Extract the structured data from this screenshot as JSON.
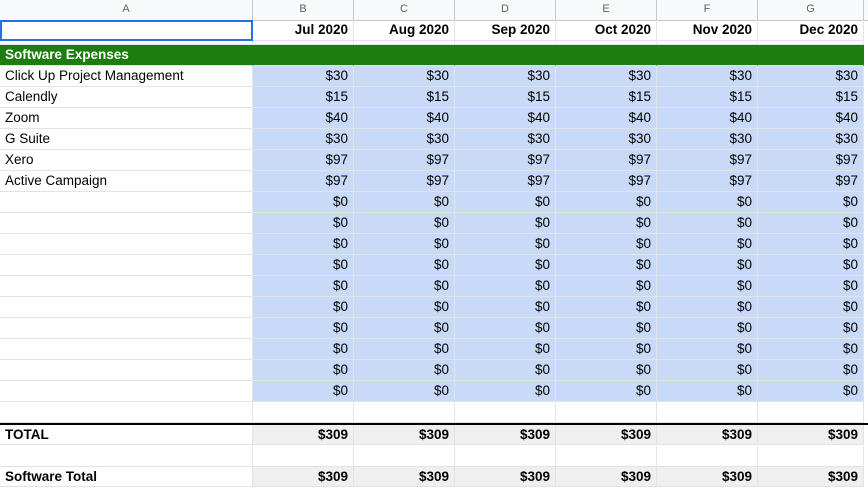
{
  "columns": [
    "A",
    "B",
    "C",
    "D",
    "E",
    "F",
    "G"
  ],
  "months": [
    "Jul 2020",
    "Aug 2020",
    "Sep 2020",
    "Oct 2020",
    "Nov 2020",
    "Dec 2020"
  ],
  "section_title": "Software Expenses",
  "rows": [
    {
      "label": "Click Up Project Management",
      "values": [
        "$30",
        "$30",
        "$30",
        "$30",
        "$30",
        "$30"
      ]
    },
    {
      "label": "Calendly",
      "values": [
        "$15",
        "$15",
        "$15",
        "$15",
        "$15",
        "$15"
      ]
    },
    {
      "label": "Zoom",
      "values": [
        "$40",
        "$40",
        "$40",
        "$40",
        "$40",
        "$40"
      ]
    },
    {
      "label": "G Suite",
      "values": [
        "$30",
        "$30",
        "$30",
        "$30",
        "$30",
        "$30"
      ]
    },
    {
      "label": "Xero",
      "values": [
        "$97",
        "$97",
        "$97",
        "$97",
        "$97",
        "$97"
      ]
    },
    {
      "label": "Active Campaign",
      "values": [
        "$97",
        "$97",
        "$97",
        "$97",
        "$97",
        "$97"
      ]
    },
    {
      "label": "",
      "values": [
        "$0",
        "$0",
        "$0",
        "$0",
        "$0",
        "$0"
      ]
    },
    {
      "label": "",
      "values": [
        "$0",
        "$0",
        "$0",
        "$0",
        "$0",
        "$0"
      ]
    },
    {
      "label": "",
      "values": [
        "$0",
        "$0",
        "$0",
        "$0",
        "$0",
        "$0"
      ]
    },
    {
      "label": "",
      "values": [
        "$0",
        "$0",
        "$0",
        "$0",
        "$0",
        "$0"
      ]
    },
    {
      "label": "",
      "values": [
        "$0",
        "$0",
        "$0",
        "$0",
        "$0",
        "$0"
      ]
    },
    {
      "label": "",
      "values": [
        "$0",
        "$0",
        "$0",
        "$0",
        "$0",
        "$0"
      ]
    },
    {
      "label": "",
      "values": [
        "$0",
        "$0",
        "$0",
        "$0",
        "$0",
        "$0"
      ]
    },
    {
      "label": "",
      "values": [
        "$0",
        "$0",
        "$0",
        "$0",
        "$0",
        "$0"
      ]
    },
    {
      "label": "",
      "values": [
        "$0",
        "$0",
        "$0",
        "$0",
        "$0",
        "$0"
      ]
    },
    {
      "label": "",
      "values": [
        "$0",
        "$0",
        "$0",
        "$0",
        "$0",
        "$0"
      ]
    }
  ],
  "total": {
    "label": "TOTAL",
    "values": [
      "$309",
      "$309",
      "$309",
      "$309",
      "$309",
      "$309"
    ]
  },
  "software_total": {
    "label": "Software Total",
    "values": [
      "$309",
      "$309",
      "$309",
      "$309",
      "$309",
      "$309"
    ]
  },
  "colors": {
    "section_green": "#1e7d0f",
    "data_blue": "#c9daf8",
    "total_gray": "#efefef",
    "selection": "#1a73e8"
  }
}
